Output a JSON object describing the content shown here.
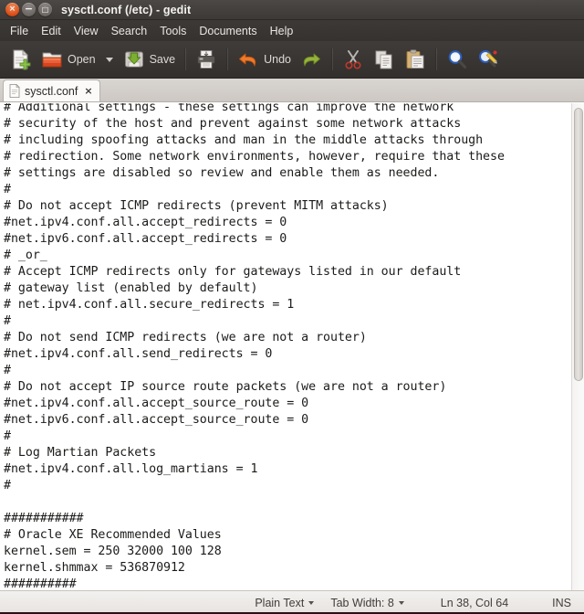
{
  "window": {
    "title": "sysctl.conf (/etc) - gedit",
    "controls": [
      {
        "name": "close",
        "glyph": "×"
      },
      {
        "name": "minimize",
        "glyph": "−"
      },
      {
        "name": "maximize",
        "glyph": "□"
      }
    ]
  },
  "menubar": {
    "items": [
      {
        "label": "File"
      },
      {
        "label": "Edit"
      },
      {
        "label": "View"
      },
      {
        "label": "Search"
      },
      {
        "label": "Tools"
      },
      {
        "label": "Documents"
      },
      {
        "label": "Help"
      }
    ]
  },
  "toolbar": {
    "new_label": "",
    "open_label": "Open",
    "save_label": "Save",
    "print_label": "",
    "undo_label": "Undo",
    "redo_label": "",
    "cut_label": "",
    "copy_label": "",
    "paste_label": "",
    "find_label": "",
    "replace_label": "",
    "icons": {
      "new": "new-document-icon",
      "open": "open-folder-icon",
      "open_dropdown": "chevron-down-icon",
      "save": "save-disk-icon",
      "print": "printer-icon",
      "undo": "undo-arrow-icon",
      "redo": "redo-arrow-icon",
      "cut": "scissors-icon",
      "copy": "copy-pages-icon",
      "paste": "clipboard-paste-icon",
      "find": "magnifier-icon",
      "replace": "magnifier-pencil-icon"
    }
  },
  "tabs": [
    {
      "label": "sysctl.conf",
      "close_glyph": "×",
      "icon": "text-file-icon",
      "active": true
    }
  ],
  "editor": {
    "content": "# Additional settings - these settings can improve the network\n# security of the host and prevent against some network attacks\n# including spoofing attacks and man in the middle attacks through\n# redirection. Some network environments, however, require that these\n# settings are disabled so review and enable them as needed.\n#\n# Do not accept ICMP redirects (prevent MITM attacks)\n#net.ipv4.conf.all.accept_redirects = 0\n#net.ipv6.conf.all.accept_redirects = 0\n# _or_\n# Accept ICMP redirects only for gateways listed in our default\n# gateway list (enabled by default)\n# net.ipv4.conf.all.secure_redirects = 1\n#\n# Do not send ICMP redirects (we are not a router)\n#net.ipv4.conf.all.send_redirects = 0\n#\n# Do not accept IP source route packets (we are not a router)\n#net.ipv4.conf.all.accept_source_route = 0\n#net.ipv6.conf.all.accept_source_route = 0\n#\n# Log Martian Packets\n#net.ipv4.conf.all.log_martians = 1\n#\n\n###########\n# Oracle XE Recommended Values\nkernel.sem = 250 32000 100 128\nkernel.shmmax = 536870912\n##########\n"
  },
  "scrollbar": {
    "thumb_top_pct": 1,
    "thumb_height_pct": 56
  },
  "statusbar": {
    "language": "Plain Text",
    "tab_width": "Tab Width: 8",
    "cursor_position": "Ln 38, Col 64",
    "insert_mode": "INS"
  },
  "colors": {
    "titlebar": "#3c3936",
    "toolbar": "#3a3734",
    "close_button": "#d94b14",
    "editor_bg": "#ffffff",
    "editor_fg": "#1c1b1a",
    "statusbar_bg": "#eceae7"
  }
}
